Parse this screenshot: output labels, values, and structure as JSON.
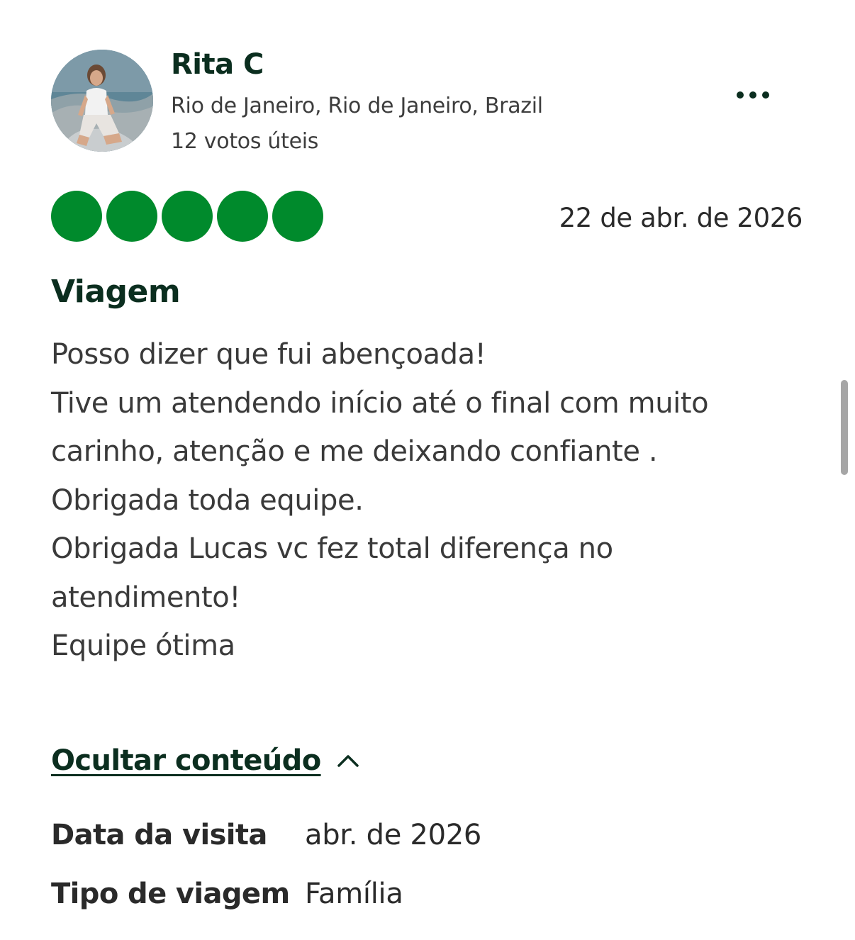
{
  "reviewer": {
    "name": "Rita C",
    "location": "Rio de Janeiro, Rio de Janeiro, Brazil",
    "votes": "12 votos úteis"
  },
  "menu": {
    "icon": "more-horizontal-icon"
  },
  "review": {
    "rating": 5,
    "rating_max": 5,
    "rating_color": "#008a2c",
    "date": "22 de abr. de 2026",
    "title": "Viagem",
    "body_lines": [
      "Posso dizer que fui abençoada!",
      "Tive um atendendo início até o final com muito",
      "carinho, atenção e me deixando confiante .",
      "Obrigada toda equipe.",
      "Obrigada Lucas vc fez total diferença no",
      "atendimento!",
      "Equipe ótima"
    ]
  },
  "collapse": {
    "label": "Ocultar conteúdo",
    "icon": "chevron-up-icon"
  },
  "details": {
    "visit_label": "Data da visita",
    "visit_value": "abr. de 2026",
    "trip_label": "Tipo de viagem",
    "trip_value": "Família"
  },
  "colors": {
    "title_green": "#0b2e1f",
    "bubble_green": "#008a2c"
  }
}
